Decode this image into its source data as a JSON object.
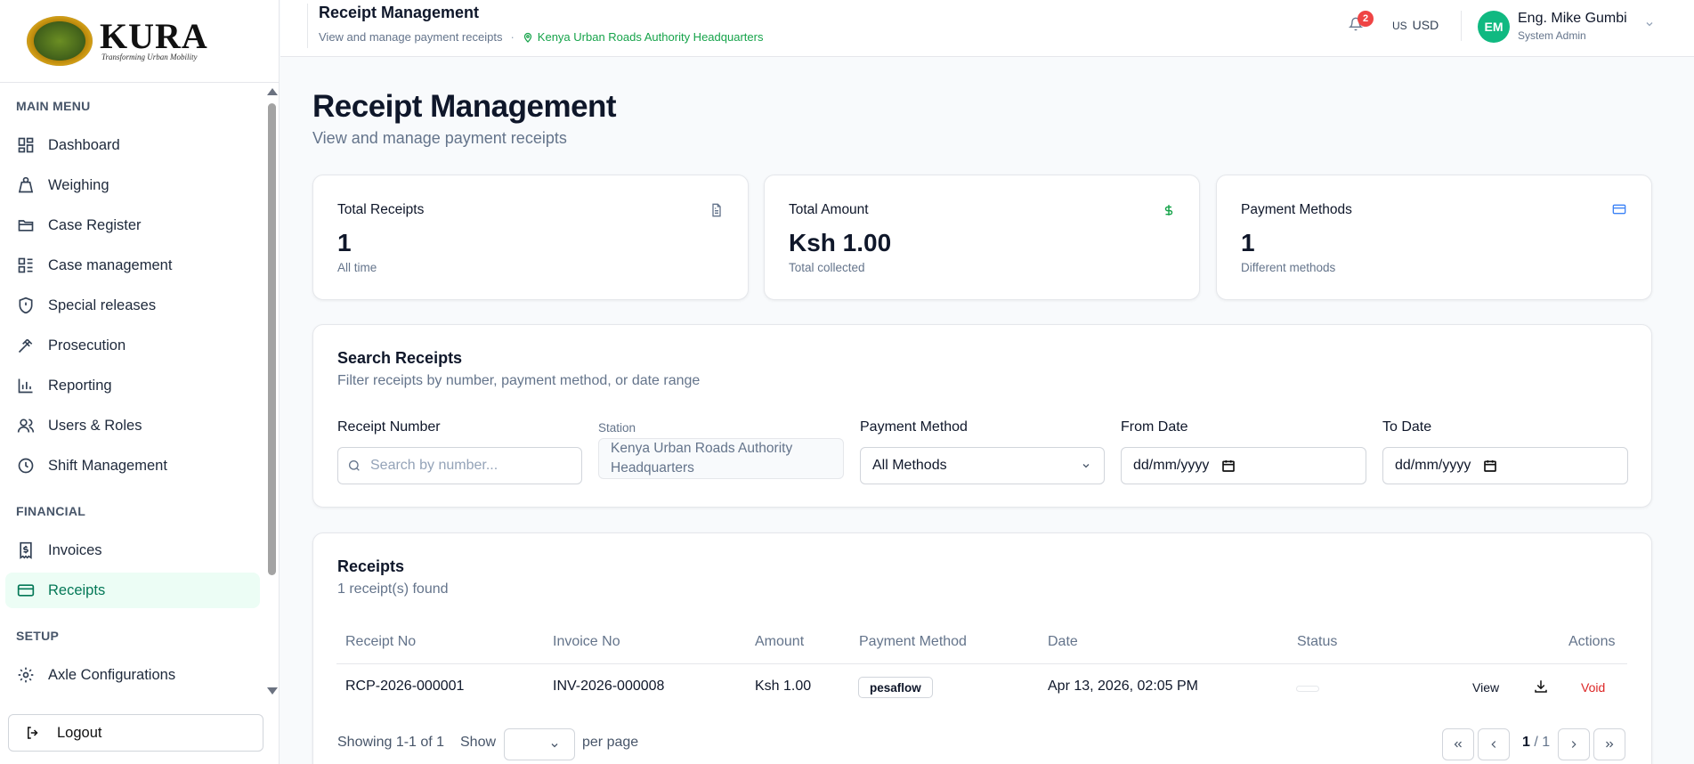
{
  "brand": {
    "name": "KURA",
    "tagline": "Transforming Urban Mobility"
  },
  "sidebar": {
    "sections": [
      {
        "title": "MAIN MENU"
      },
      {
        "title": "FINANCIAL"
      },
      {
        "title": "SETUP"
      }
    ],
    "items": [
      {
        "label": "Dashboard",
        "icon": "dashboard-icon"
      },
      {
        "label": "Weighing",
        "icon": "weight-icon"
      },
      {
        "label": "Case Register",
        "icon": "folder-icon"
      },
      {
        "label": "Case management",
        "icon": "list-icon"
      },
      {
        "label": "Special releases",
        "icon": "shield-icon"
      },
      {
        "label": "Prosecution",
        "icon": "gavel-icon"
      },
      {
        "label": "Reporting",
        "icon": "bar-chart-icon"
      },
      {
        "label": "Users & Roles",
        "icon": "users-icon"
      },
      {
        "label": "Shift Management",
        "icon": "clock-icon"
      },
      {
        "label": "Invoices",
        "icon": "invoice-icon"
      },
      {
        "label": "Receipts",
        "icon": "credit-card-icon",
        "active": true
      },
      {
        "label": "Axle Configurations",
        "icon": "gear-icon"
      }
    ],
    "logout_label": "Logout"
  },
  "header": {
    "title": "Receipt Management",
    "subtitle": "View and manage payment receipts",
    "station": "Kenya Urban Roads Authority Headquarters",
    "notification_count": "2",
    "currency_flag": "US",
    "currency": "USD",
    "user_initials": "EM",
    "user_name": "Eng. Mike Gumbi",
    "user_role": "System Admin"
  },
  "page": {
    "title": "Receipt Management",
    "subtitle": "View and manage payment receipts"
  },
  "stats": [
    {
      "label": "Total Receipts",
      "value": "1",
      "note": "All time",
      "icon": "document-icon"
    },
    {
      "label": "Total Amount",
      "value": "Ksh 1.00",
      "note": "Total collected",
      "icon": "dollar-icon"
    },
    {
      "label": "Payment Methods",
      "value": "1",
      "note": "Different methods",
      "icon": "credit-card-icon"
    }
  ],
  "search": {
    "title": "Search Receipts",
    "subtitle": "Filter receipts by number, payment method, or date range",
    "receipt_label": "Receipt Number",
    "receipt_placeholder": "Search by number...",
    "station_label": "Station",
    "station_value": "Kenya Urban Roads Authority Headquarters",
    "method_label": "Payment Method",
    "method_value": "All Methods",
    "from_label": "From Date",
    "from_value": "dd/mm/yyyy",
    "to_label": "To Date",
    "to_value": "dd/mm/yyyy"
  },
  "receipts": {
    "title": "Receipts",
    "count_text": "1 receipt(s) found",
    "columns": [
      "Receipt No",
      "Invoice No",
      "Amount",
      "Payment Method",
      "Date",
      "Status",
      "Actions"
    ],
    "rows": [
      {
        "receipt_no": "RCP-2026-000001",
        "invoice_no": "INV-2026-000008",
        "amount": "Ksh 1.00",
        "method": "pesaflow",
        "date": "Apr 13, 2026, 02:05 PM",
        "status": "",
        "view_label": "View",
        "void_label": "Void"
      }
    ],
    "showing": "Showing 1-1 of 1",
    "show_label": "Show",
    "per_page_label": "per page",
    "page_current": "1",
    "page_total": "/ 1"
  },
  "colors": {
    "accent": "#10b981",
    "active_bg": "#ecfdf5",
    "active_text": "#047857",
    "danger": "#dc2626",
    "link_green": "#16a34a"
  }
}
